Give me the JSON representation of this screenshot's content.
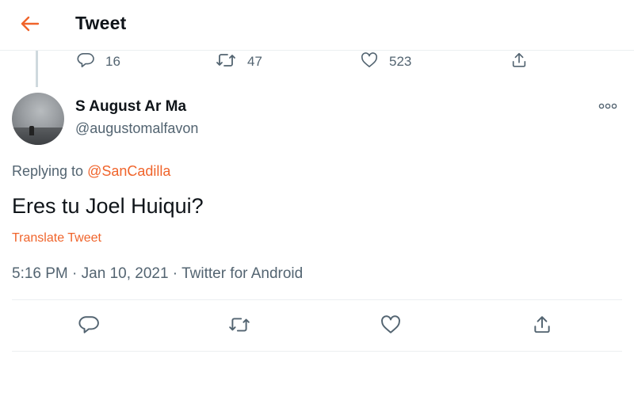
{
  "header": {
    "title": "Tweet",
    "back_icon": "arrow-left-icon",
    "accent_color": "#f0642b"
  },
  "previous_tweet_actions": {
    "replies": "16",
    "retweets": "47",
    "likes": "523"
  },
  "tweet": {
    "author": {
      "display_name": "S August Ar Ma",
      "handle": "@augustomalfavon"
    },
    "replying_prefix": "Replying to ",
    "replying_to": "@SanCadilla",
    "text": "Eres tu Joel Huiqui?",
    "translate_label": "Translate Tweet",
    "time": "5:16 PM",
    "date": "Jan 10, 2021",
    "source": "Twitter for Android",
    "separator": " · "
  },
  "actions": [
    "reply-icon",
    "retweet-icon",
    "like-icon",
    "share-icon"
  ],
  "colors": {
    "secondary_text": "#536471",
    "primary_text": "#0f1419",
    "link": "#f0642b"
  }
}
